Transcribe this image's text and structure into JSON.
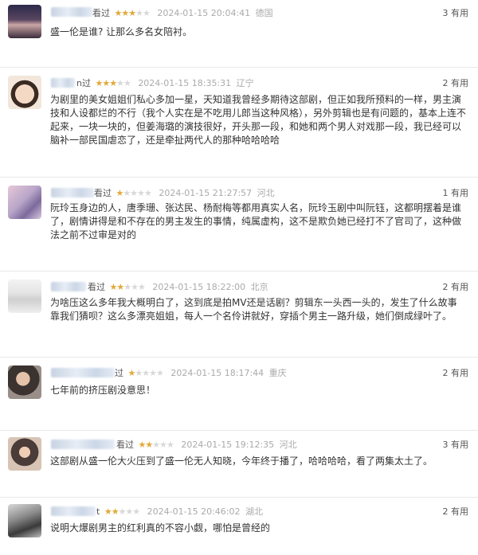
{
  "reviews": [
    {
      "name_tail": "看过",
      "stars": [
        1,
        1,
        1,
        0,
        0
      ],
      "date": "2024-01-15 20:04:41",
      "location": "德国",
      "useful": "3 有用",
      "content": "盛一伦是谁? 让那么多名女陪衬。"
    },
    {
      "name_tail": "n过",
      "stars": [
        1,
        1,
        1,
        0,
        0
      ],
      "date": "2024-01-15 18:35:31",
      "location": "辽宁",
      "useful": "2 有用",
      "content": "为剧里的美女姐姐们私心多加一星，天知道我曾经多期待这部剧，但正如我所预料的一样，男主演技和人设都烂的不行（我个人实在是不吃用儿郎当这种风格），另外剪辑也是有问题的，基本上连不起来，一块一块的，但姜海璐的演技很好，开头那一段，和她和两个男人对戏那一段，我已经可以脑补一部民国虐恋了，还是牵扯两代人的那种哈哈哈哈"
    },
    {
      "name_tail": "看过",
      "stars": [
        1,
        0,
        0,
        0,
        0
      ],
      "date": "2024-01-15 21:27:57",
      "location": "河北",
      "useful": "1 有用",
      "content": "阮玲玉身边的人，唐季珊、张达民、杨耐梅等都用真实人名，阮玲玉剧中叫阮钰，这都明摆着是谁了，剧情讲得是和不存在的男主发生的事情，纯属虚构，这不是欺负她已经打不了官司了，这种做法之前不过审是对的"
    },
    {
      "name_tail": "看过",
      "stars": [
        1,
        1,
        0,
        0,
        0
      ],
      "date": "2024-01-15 18:22:00",
      "location": "北京",
      "useful": "2 有用",
      "content": "为啥压这么多年我大概明白了，这到底是拍MV还是话剧？剪辑东一头西一头的，发生了什么故事靠我们猜呗？这么多漂亮姐姐，每人一个名伶讲就好，穿插个男主一路升级，她们倒成绿叶了。"
    },
    {
      "name_tail": "过",
      "stars": [
        1,
        0,
        0,
        0,
        0
      ],
      "date": "2024-01-15 18:17:44",
      "location": "重庆",
      "useful": "2 有用",
      "content": "七年前的挤压剧没意思！"
    },
    {
      "name_tail": "看过",
      "stars": [
        1,
        1,
        0,
        0,
        0
      ],
      "date": "2024-01-15 19:12:35",
      "location": "河北",
      "useful": "3 有用",
      "content": "这部剧从盛一伦大火压到了盛一伦无人知晓，今年终于播了，哈哈哈哈，看了两集太土了。"
    },
    {
      "name_tail": "t",
      "stars": [
        1,
        1,
        0,
        0,
        0
      ],
      "date": "2024-01-15 20:46:02",
      "location": "湖北",
      "useful": "2 有用",
      "content": "说明大爆剧男主的红利真的不容小觑，哪怕是曾经的"
    }
  ],
  "colors": {
    "star_on": "#e2a93a",
    "star_off": "#d8d8d8",
    "meta_text": "#aaaaaa",
    "body_text": "#333333"
  }
}
